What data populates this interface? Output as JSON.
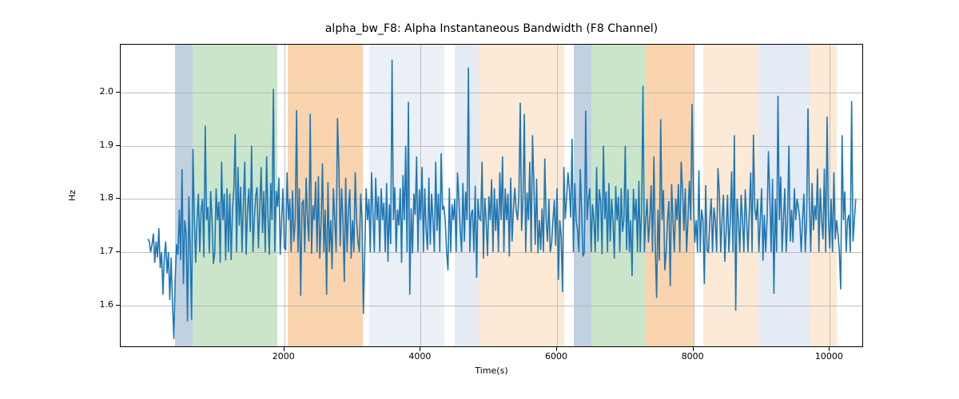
{
  "chart_data": {
    "type": "line",
    "title": "alpha_bw_F8: Alpha Instantaneous Bandwidth (F8 Channel)",
    "xlabel": "Time(s)",
    "ylabel": "Hz",
    "xlim": [
      -400,
      10500
    ],
    "ylim": [
      1.52,
      2.09
    ],
    "xticks": [
      2000,
      4000,
      6000,
      8000,
      10000
    ],
    "yticks": [
      1.6,
      1.7,
      1.8,
      1.9,
      2.0
    ],
    "bands": [
      {
        "x0": 400,
        "x1": 650,
        "color": "#b7c9db",
        "alpha": 0.85
      },
      {
        "x0": 650,
        "x1": 1900,
        "color": "#c2e0c2",
        "alpha": 0.85
      },
      {
        "x0": 2050,
        "x1": 3150,
        "color": "#f9cda0",
        "alpha": 0.85
      },
      {
        "x0": 3250,
        "x1": 4350,
        "color": "#e6edf5",
        "alpha": 0.85
      },
      {
        "x0": 4500,
        "x1": 4850,
        "color": "#dfe8f2",
        "alpha": 0.85
      },
      {
        "x0": 4850,
        "x1": 6100,
        "color": "#fbe6cf",
        "alpha": 0.85
      },
      {
        "x0": 6250,
        "x1": 6500,
        "color": "#b7c9db",
        "alpha": 0.85
      },
      {
        "x0": 6500,
        "x1": 7300,
        "color": "#c2e0c2",
        "alpha": 0.85
      },
      {
        "x0": 7300,
        "x1": 8000,
        "color": "#f9cda0",
        "alpha": 0.85
      },
      {
        "x0": 8150,
        "x1": 8950,
        "color": "#fbe6cf",
        "alpha": 0.85
      },
      {
        "x0": 8950,
        "x1": 9700,
        "color": "#dfe8f2",
        "alpha": 0.85
      },
      {
        "x0": 9700,
        "x1": 10100,
        "color": "#fbe6cf",
        "alpha": 0.85
      }
    ],
    "series": [
      {
        "name": "alpha_bw_F8",
        "color": "#1f77b4",
        "x_start": 0,
        "x_step": 20,
        "values": [
          1.725,
          1.72,
          1.7,
          1.715,
          1.735,
          1.68,
          1.72,
          1.69,
          1.745,
          1.67,
          1.7,
          1.62,
          1.69,
          1.72,
          1.66,
          1.7,
          1.61,
          1.69,
          1.605,
          1.537,
          1.65,
          1.715,
          1.695,
          1.78,
          1.685,
          1.856,
          1.64,
          1.76,
          1.735,
          1.57,
          1.805,
          1.7,
          1.573,
          1.894,
          1.763,
          1.68,
          1.76,
          1.81,
          1.7,
          1.78,
          1.8,
          1.69,
          1.938,
          1.76,
          1.785,
          1.698,
          1.815,
          1.76,
          1.678,
          1.7,
          1.82,
          1.76,
          1.795,
          1.68,
          1.87,
          1.76,
          1.81,
          1.684,
          1.82,
          1.7,
          1.81,
          1.685,
          1.78,
          1.82,
          1.922,
          1.7,
          1.86,
          1.75,
          1.823,
          1.7,
          1.79,
          1.87,
          1.695,
          1.78,
          1.82,
          1.738,
          1.9,
          1.7,
          1.76,
          1.805,
          1.822,
          1.707,
          1.785,
          1.86,
          1.736,
          1.815,
          1.7,
          1.88,
          1.768,
          1.695,
          1.83,
          1.76,
          2.007,
          1.7,
          1.815,
          1.785,
          1.84,
          1.695,
          1.76,
          1.82,
          1.708,
          1.705,
          1.85,
          1.76,
          1.8,
          1.7,
          1.816,
          1.72,
          1.76,
          1.967,
          1.7,
          1.82,
          1.618,
          1.792,
          1.798,
          1.7,
          1.84,
          1.76,
          1.72,
          1.96,
          1.697,
          1.788,
          1.76,
          1.833,
          1.7,
          1.843,
          1.688,
          1.758,
          1.867,
          1.7,
          1.78,
          1.62,
          1.832,
          1.7,
          1.76,
          1.668,
          1.82,
          1.76,
          1.7,
          1.952,
          1.86,
          1.711,
          1.82,
          1.76,
          1.644,
          1.84,
          1.7,
          1.78,
          1.818,
          1.688,
          1.76,
          1.7,
          1.85,
          1.76,
          1.72,
          1.7,
          1.81,
          1.76,
          1.584,
          1.7,
          1.82,
          1.76,
          1.8,
          1.7,
          1.85,
          1.77,
          1.7,
          1.84,
          1.76,
          1.805,
          1.7,
          1.82,
          1.76,
          1.793,
          1.7,
          1.83,
          1.682,
          1.79,
          1.715,
          2.062,
          1.76,
          1.822,
          1.7,
          1.78,
          1.75,
          1.82,
          1.68,
          1.845,
          1.76,
          1.9,
          1.7,
          1.983,
          1.62,
          1.782,
          1.698,
          1.81,
          1.77,
          1.88,
          1.7,
          1.818,
          1.76,
          1.86,
          1.7,
          1.82,
          1.742,
          1.704,
          1.84,
          1.714,
          1.81,
          1.76,
          1.7,
          1.87,
          1.74,
          1.81,
          1.7,
          1.886,
          1.78,
          1.785,
          1.76,
          1.7,
          1.666,
          1.821,
          1.7,
          1.79,
          1.76,
          1.8,
          1.7,
          1.85,
          1.8,
          1.741,
          1.7,
          1.83,
          1.72,
          1.814,
          1.76,
          2.047,
          1.7,
          1.77,
          1.78,
          1.7,
          1.825,
          1.652,
          1.8,
          1.763,
          1.76,
          1.87,
          1.688,
          1.802,
          1.76,
          1.693,
          1.805,
          1.76,
          1.837,
          1.7,
          1.82,
          1.74,
          1.8,
          1.7,
          1.85,
          1.76,
          1.88,
          1.7,
          1.82,
          1.76,
          1.81,
          1.692,
          1.84,
          1.72,
          1.782,
          1.821,
          1.78,
          1.76,
          1.804,
          1.981,
          1.74,
          1.797,
          1.96,
          1.7,
          1.812,
          1.76,
          1.87,
          1.7,
          1.92,
          1.826,
          1.714,
          1.838,
          1.698,
          1.76,
          1.704,
          1.782,
          1.7,
          1.876,
          1.76,
          1.72,
          1.8,
          1.7,
          1.717,
          1.76,
          1.798,
          1.712,
          1.82,
          1.648,
          1.76,
          1.73,
          1.625,
          1.86,
          1.762,
          1.801,
          1.85,
          1.82,
          1.765,
          1.913,
          1.7,
          1.83,
          1.76,
          1.742,
          1.7,
          1.856,
          1.78,
          1.692,
          1.7,
          1.966,
          1.76,
          1.8,
          1.82,
          1.7,
          1.79,
          1.762,
          1.7,
          1.86,
          1.72,
          1.818,
          1.795,
          1.696,
          1.9,
          1.762,
          1.814,
          1.7,
          1.83,
          1.72,
          1.8,
          1.76,
          1.688,
          1.824,
          1.76,
          1.804,
          1.7,
          1.82,
          1.738,
          1.76,
          1.9,
          1.704,
          1.818,
          1.7,
          1.76,
          1.655,
          1.819,
          1.76,
          1.8,
          1.7,
          1.834,
          1.7,
          1.78,
          2.013,
          1.7,
          1.76,
          1.8,
          1.718,
          1.76,
          1.826,
          1.7,
          1.88,
          1.712,
          1.614,
          1.78,
          1.684,
          1.95,
          1.76,
          1.817,
          1.666,
          1.7,
          1.76,
          1.796,
          1.636,
          1.828,
          1.76,
          1.7,
          1.8,
          1.76,
          1.828,
          1.7,
          1.87,
          1.82,
          1.74,
          1.82,
          1.7,
          1.763,
          1.834,
          1.76,
          1.979,
          1.804,
          1.718,
          1.76,
          1.7,
          1.854,
          1.7,
          1.78,
          1.76,
          1.64,
          1.826,
          1.703,
          1.7,
          1.76,
          1.801,
          1.7,
          1.784,
          1.76,
          1.7,
          1.858,
          1.811,
          1.7,
          1.76,
          1.808,
          1.682,
          1.74,
          1.808,
          1.7,
          1.76,
          1.852,
          1.7,
          1.92,
          1.59,
          1.8,
          1.76,
          1.7,
          1.808,
          1.76,
          1.7,
          1.818,
          1.76,
          1.7,
          1.78,
          1.85,
          1.7,
          1.921,
          1.782,
          1.76,
          1.8,
          1.7,
          1.76,
          1.82,
          1.684,
          1.77,
          1.7,
          1.76,
          1.89,
          1.804,
          1.7,
          1.838,
          1.622,
          1.8,
          1.7,
          1.994,
          1.76,
          1.842,
          1.7,
          1.76,
          1.82,
          1.7,
          1.76,
          1.9,
          1.72,
          1.78,
          1.718,
          1.82,
          1.76,
          1.8,
          1.784,
          1.76,
          1.7,
          1.76,
          1.81,
          1.7,
          1.76,
          1.97,
          1.792,
          1.7,
          1.83,
          1.741,
          1.788,
          1.76,
          1.857,
          1.7,
          1.82,
          1.76,
          1.724,
          1.857,
          1.7,
          1.955,
          1.76,
          1.707,
          1.8,
          1.7,
          1.85,
          1.724,
          1.76,
          1.734,
          1.7,
          1.63,
          1.92,
          1.76,
          1.814,
          1.7,
          1.76,
          1.77,
          1.7,
          1.984,
          1.72,
          1.76,
          1.8
        ]
      }
    ]
  }
}
